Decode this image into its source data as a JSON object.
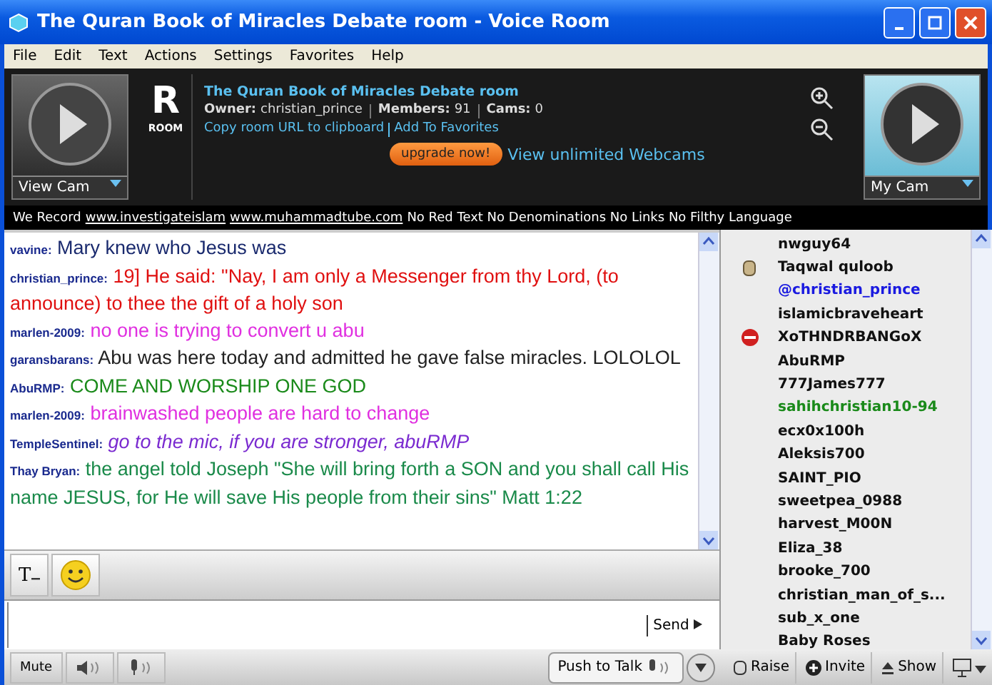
{
  "window": {
    "title": "The Quran Book of Miracles Debate room - Voice Room"
  },
  "menu": [
    "File",
    "Edit",
    "Text",
    "Actions",
    "Settings",
    "Favorites",
    "Help"
  ],
  "header": {
    "view_cam": "View Cam",
    "room_letter": "R",
    "room_label": "ROOM",
    "room_name": "The Quran Book of Miracles Debate room",
    "owner_label": "Owner:",
    "owner": "christian_prince",
    "members_label": "Members:",
    "members": "91",
    "cams_label": "Cams:",
    "cams": "0",
    "copy_link": "Copy room URL to clipboard",
    "favorites_link": "Add To Favorites",
    "upgrade_button": "upgrade now!",
    "webcams_link": "View unlimited Webcams",
    "my_cam": "My Cam"
  },
  "rules": {
    "prefix": "We Record",
    "link_1": "www.investigateislam",
    "link_2": "www.muhammadtube.com",
    "suffix": "No Red Text No Denominations No Links No Filthy Language"
  },
  "messages": [
    {
      "user": "vavine:",
      "text": "Mary knew who Jesus was",
      "color": "#1a2a6e",
      "italic": false
    },
    {
      "user": "christian_prince:",
      "text": "19] He said: \"Nay, I am only a Messenger from thy Lord, (to announce) to thee the gift of a holy son",
      "color": "#e01010",
      "italic": false
    },
    {
      "user": "marlen-2009:",
      "text": "no one is trying to convert u abu",
      "color": "#e030e0",
      "italic": false
    },
    {
      "user": "garansbarans:",
      "text": "Abu was here today and admitted he gave false miracles. LOLOLOL",
      "color": "#222222",
      "italic": false
    },
    {
      "user": "AbuRMP:",
      "text": "COME AND WORSHIP ONE GOD",
      "color": "#1a8a1a",
      "italic": false
    },
    {
      "user": "marlen-2009:",
      "text": "brainwashed people are hard to change",
      "color": "#e030e0",
      "italic": false
    },
    {
      "user": "TempleSentinel:",
      "text": "go to the mic, if you are stronger, abuRMP",
      "color": "#7a2ad0",
      "italic": true
    },
    {
      "user": "Thay Bryan:",
      "text": "the angel told Joseph \"She will bring forth a SON and you shall call His name JESUS, for He will save His people from their sins\" Matt 1:22",
      "color": "#1a8a4a",
      "italic": false
    }
  ],
  "users": [
    {
      "name": "nwguy64",
      "color": "#111111",
      "kind": "plain"
    },
    {
      "name": "Taqwal quloob",
      "color": "#111111",
      "kind": "hand"
    },
    {
      "name": "@christian_prince",
      "color": "#1a1ae0",
      "kind": "plain"
    },
    {
      "name": "islamicbraveheart",
      "color": "#111111",
      "kind": "plain"
    },
    {
      "name": "XoTHNDRBANGoX",
      "color": "#111111",
      "kind": "blocked"
    },
    {
      "name": "AbuRMP",
      "color": "#111111",
      "kind": "plain"
    },
    {
      "name": "777James777",
      "color": "#111111",
      "kind": "plain"
    },
    {
      "name": "sahihchristian10-94",
      "color": "#1a8a1a",
      "kind": "plain"
    },
    {
      "name": "ecx0x100h",
      "color": "#111111",
      "kind": "plain"
    },
    {
      "name": "Aleksis700",
      "color": "#111111",
      "kind": "plain"
    },
    {
      "name": "SAINT_PIO",
      "color": "#111111",
      "kind": "plain"
    },
    {
      "name": "sweetpea_0988",
      "color": "#111111",
      "kind": "plain"
    },
    {
      "name": "harvest_M00N",
      "color": "#111111",
      "kind": "plain"
    },
    {
      "name": "Eliza_38",
      "color": "#111111",
      "kind": "plain"
    },
    {
      "name": "brooke_700",
      "color": "#111111",
      "kind": "plain"
    },
    {
      "name": "christian_man_of_s...",
      "color": "#111111",
      "kind": "plain"
    },
    {
      "name": "sub_x_one",
      "color": "#111111",
      "kind": "plain"
    },
    {
      "name": "Baby Roses",
      "color": "#111111",
      "kind": "plain"
    }
  ],
  "compose": {
    "font_button": "T",
    "send_button": "Send"
  },
  "bottom": {
    "mute": "Mute",
    "push_to_talk": "Push to Talk",
    "raise": "Raise",
    "invite": "Invite",
    "show": "Show"
  }
}
